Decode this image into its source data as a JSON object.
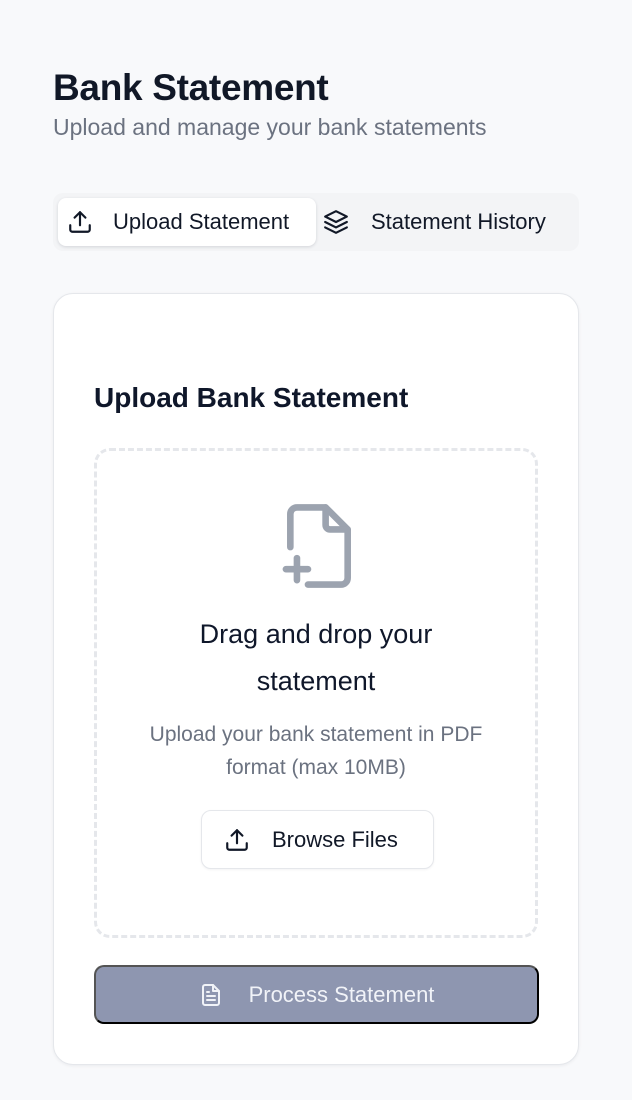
{
  "header": {
    "title": "Bank Statement",
    "subtitle": "Upload and manage your bank statements"
  },
  "tabs": [
    {
      "label": "Upload Statement",
      "icon": "upload-icon",
      "active": true
    },
    {
      "label": "Statement History",
      "icon": "layers-icon",
      "active": false
    }
  ],
  "upload_card": {
    "title": "Upload Bank Statement",
    "dropzone": {
      "icon": "file-plus-icon",
      "heading": "Drag and drop your statement",
      "description": "Upload your bank statement in PDF format (max 10MB)",
      "browse_label": "Browse Files"
    },
    "process_label": "Process Statement"
  },
  "colors": {
    "background": "#f8f9fb",
    "process_button": "#8e96b0",
    "muted_text": "#6b7280",
    "icon_gray": "#9ca3af"
  }
}
